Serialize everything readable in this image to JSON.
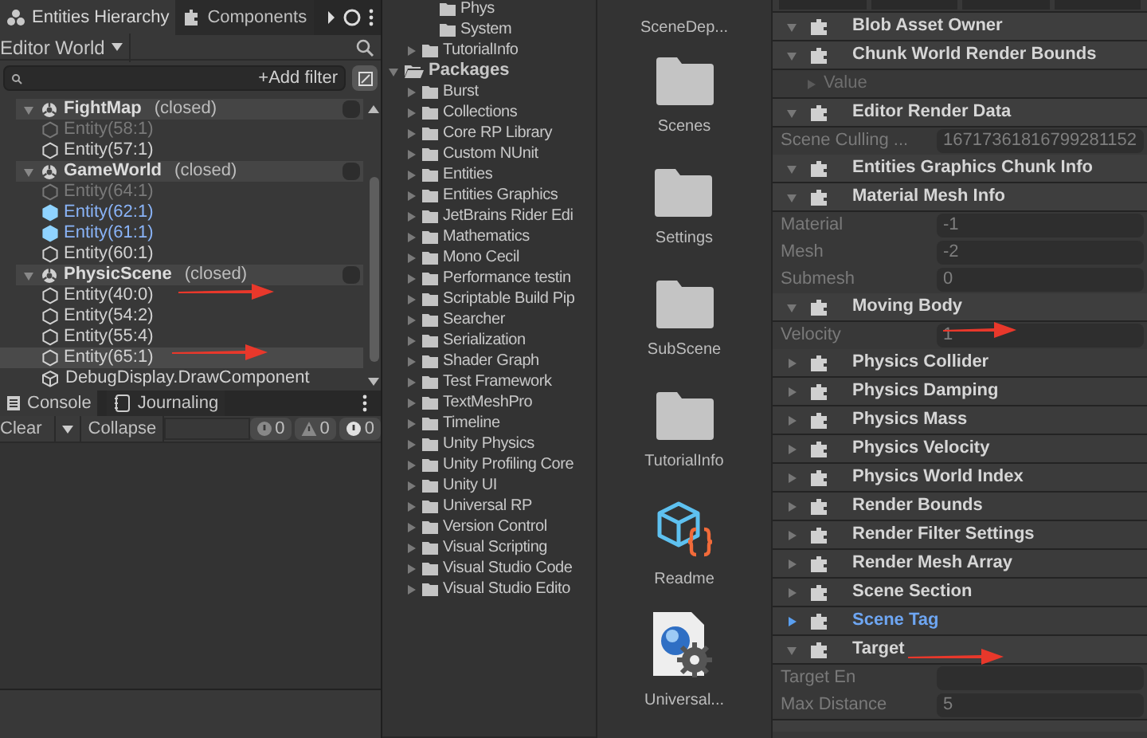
{
  "hierarchy": {
    "tabs": [
      {
        "label": "Entities Hierarchy",
        "selected": true
      },
      {
        "label": "Components",
        "selected": false
      }
    ],
    "world": "Editor World",
    "filter_button": "+Add filter",
    "groups": [
      {
        "name": "FightMap",
        "status": "(closed)",
        "expanded": true,
        "entities": [
          {
            "label": "Entity(58:1)",
            "disabled": true,
            "selected": false,
            "highlighted": false
          },
          {
            "label": "Entity(57:1)",
            "disabled": false,
            "selected": false,
            "highlighted": false
          }
        ]
      },
      {
        "name": "GameWorld",
        "status": "(closed)",
        "expanded": true,
        "entities": [
          {
            "label": "Entity(64:1)",
            "disabled": true,
            "selected": false,
            "highlighted": false
          },
          {
            "label": "Entity(62:1)",
            "disabled": false,
            "selected": true,
            "highlighted": false
          },
          {
            "label": "Entity(61:1)",
            "disabled": false,
            "selected": true,
            "highlighted": false
          },
          {
            "label": "Entity(60:1)",
            "disabled": false,
            "selected": false,
            "highlighted": false
          }
        ]
      },
      {
        "name": "PhysicScene",
        "status": "(closed)",
        "expanded": true,
        "entities": [
          {
            "label": "Entity(40:0)",
            "disabled": false,
            "selected": false,
            "highlighted": false
          },
          {
            "label": "Entity(54:2)",
            "disabled": false,
            "selected": false,
            "highlighted": false
          },
          {
            "label": "Entity(55:4)",
            "disabled": false,
            "selected": false,
            "highlighted": false
          },
          {
            "label": "Entity(65:1)",
            "disabled": false,
            "selected": false,
            "highlighted": true
          }
        ]
      }
    ],
    "root_item": "DebugDisplay.DrawComponent"
  },
  "console": {
    "tabs": [
      {
        "label": "Console",
        "selected": true
      },
      {
        "label": "Journaling",
        "selected": false
      }
    ],
    "clear": "Clear",
    "collapse": "Collapse",
    "counts": [
      {
        "kind": "info",
        "count": "0"
      },
      {
        "kind": "warning",
        "count": "0"
      },
      {
        "kind": "error",
        "count": "0"
      }
    ]
  },
  "project_tree": [
    {
      "children": [
        {
          "children": [
            {
              "label": "Phys"
            },
            {
              "label": "System"
            }
          ]
        },
        {
          "label": "TutorialInfo",
          "expanded": false
        }
      ]
    },
    {
      "label": "Packages",
      "expanded": true,
      "children": [
        {
          "label": "Burst",
          "expanded": false
        },
        {
          "label": "Collections",
          "expanded": false
        },
        {
          "label": "Core RP Library",
          "expanded": false
        },
        {
          "label": "Custom NUnit",
          "expanded": false
        },
        {
          "label": "Entities",
          "expanded": false
        },
        {
          "label": "Entities Graphics",
          "expanded": false
        },
        {
          "label": "JetBrains Rider Edi",
          "expanded": false
        },
        {
          "label": "Mathematics",
          "expanded": false
        },
        {
          "label": "Mono Cecil",
          "expanded": false
        },
        {
          "label": "Performance testin",
          "expanded": false
        },
        {
          "label": "Scriptable Build Pip",
          "expanded": false
        },
        {
          "label": "Searcher",
          "expanded": false
        },
        {
          "label": "Serialization",
          "expanded": false
        },
        {
          "label": "Shader Graph",
          "expanded": false
        },
        {
          "label": "Test Framework",
          "expanded": false
        },
        {
          "label": "TextMeshPro",
          "expanded": false
        },
        {
          "label": "Timeline",
          "expanded": false
        },
        {
          "label": "Unity Physics",
          "expanded": false
        },
        {
          "label": "Unity Profiling Core",
          "expanded": false
        },
        {
          "label": "Unity UI",
          "expanded": false
        },
        {
          "label": "Universal RP",
          "expanded": false
        },
        {
          "label": "Version Control",
          "expanded": false
        },
        {
          "label": "Visual Scripting",
          "expanded": false
        },
        {
          "label": "Visual Studio Code",
          "expanded": false
        },
        {
          "label": "Visual Studio Edito",
          "expanded": false
        }
      ]
    }
  ],
  "assets": [
    {
      "kind": "cut",
      "label": "SceneDep..."
    },
    {
      "kind": "folder",
      "label": "Scenes"
    },
    {
      "kind": "folder",
      "label": "Settings"
    },
    {
      "kind": "folder",
      "label": "SubScene"
    },
    {
      "kind": "folder",
      "label": "TutorialInfo"
    },
    {
      "kind": "readme",
      "label": "Readme"
    },
    {
      "kind": "settings_asset",
      "label": "Universal..."
    }
  ],
  "inspector": [
    {
      "kind": "header",
      "label": "Blob Asset Owner",
      "expanded": true,
      "selected": false
    },
    {
      "kind": "header",
      "label": "Chunk World Render Bounds",
      "expanded": true,
      "selected": false
    },
    {
      "kind": "sub",
      "label": "Value",
      "expanded": false
    },
    {
      "kind": "header",
      "label": "Editor Render Data",
      "expanded": true,
      "selected": false
    },
    {
      "kind": "field",
      "label": "Scene Culling ...",
      "value": "16717361816799281152"
    },
    {
      "kind": "header",
      "label": "Entities Graphics Chunk Info",
      "expanded": true,
      "selected": false
    },
    {
      "kind": "header",
      "label": "Material Mesh Info",
      "expanded": true,
      "selected": false
    },
    {
      "kind": "field",
      "label": "Material",
      "value": "-1"
    },
    {
      "kind": "field",
      "label": "Mesh",
      "value": "-2"
    },
    {
      "kind": "field",
      "label": "Submesh",
      "value": "0"
    },
    {
      "kind": "header",
      "label": "Moving Body",
      "expanded": true,
      "selected": false
    },
    {
      "kind": "field",
      "label": "Velocity",
      "value": "1"
    },
    {
      "kind": "header",
      "label": "Physics Collider",
      "expanded": false,
      "selected": false
    },
    {
      "kind": "header",
      "label": "Physics Damping",
      "expanded": false,
      "selected": false
    },
    {
      "kind": "header",
      "label": "Physics Mass",
      "expanded": false,
      "selected": false
    },
    {
      "kind": "header",
      "label": "Physics Velocity",
      "expanded": false,
      "selected": false
    },
    {
      "kind": "header",
      "label": "Physics World Index",
      "expanded": false,
      "selected": false
    },
    {
      "kind": "header",
      "label": "Render Bounds",
      "expanded": false,
      "selected": false
    },
    {
      "kind": "header",
      "label": "Render Filter Settings",
      "expanded": false,
      "selected": false
    },
    {
      "kind": "header",
      "label": "Render Mesh Array",
      "expanded": false,
      "selected": false
    },
    {
      "kind": "header",
      "label": "Scene Section",
      "expanded": false,
      "selected": false
    },
    {
      "kind": "header",
      "label": "Scene Tag",
      "expanded": false,
      "selected": true
    },
    {
      "kind": "header",
      "label": "Target",
      "expanded": true,
      "selected": false
    },
    {
      "kind": "field",
      "label": "Target En"
    },
    {
      "kind": "field",
      "label": "Max Distance",
      "value": "5"
    }
  ]
}
